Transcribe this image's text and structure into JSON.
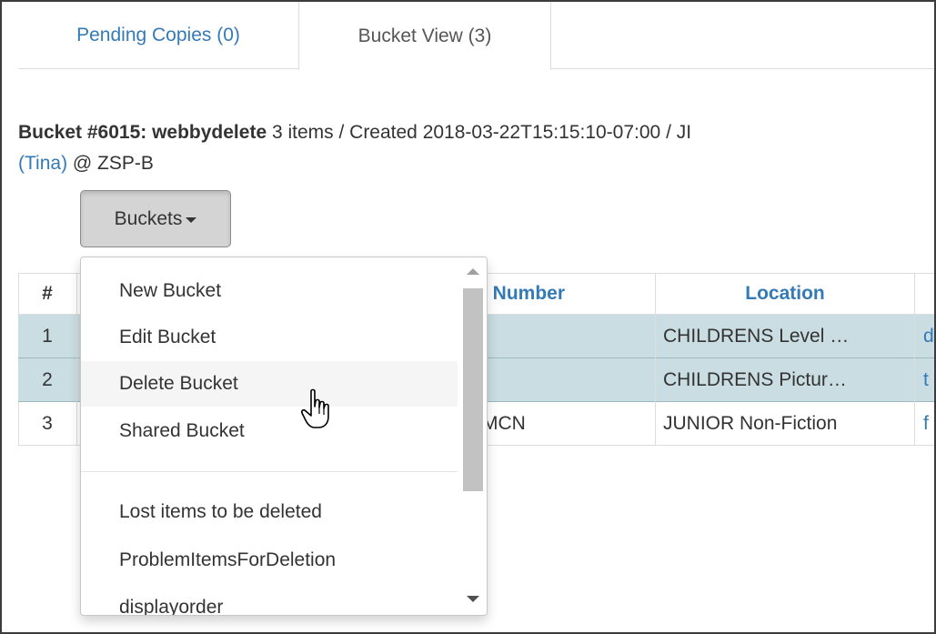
{
  "tabs": {
    "pending": "Pending Copies (0)",
    "bucket_view": "Bucket View (3)"
  },
  "bucket": {
    "title": "Bucket #6015: webbydelete",
    "meta": " 3 items / Created 2018-03-22T15:15:10-07:00 / JI",
    "user": "(Tina)",
    "location": " @ ZSP-B"
  },
  "buckets_button": {
    "label": "Buckets"
  },
  "table": {
    "headers": {
      "num": "#",
      "call_number": "l Number",
      "location": "Location"
    },
    "rows": [
      {
        "num": "1",
        "call": "",
        "location": "CHILDRENS Level …",
        "extra": "d",
        "selected": true
      },
      {
        "num": "2",
        "call": "",
        "location": "CHILDRENS Pictur…",
        "extra": "t",
        "selected": true
      },
      {
        "num": "3",
        "call": "MCN",
        "location": "JUNIOR Non-Fiction",
        "extra": "f",
        "selected": false
      }
    ]
  },
  "menu": {
    "items": [
      "New Bucket",
      "Edit Bucket",
      "Delete Bucket",
      "Shared Bucket"
    ],
    "saved_buckets": [
      "Lost items to be deleted",
      "ProblemItemsForDeletion",
      "displayorder"
    ],
    "hovered": "Delete Bucket"
  },
  "colors": {
    "link": "#337ab7",
    "selected_row": "#c9dde2",
    "button_bg": "#d4d4d4"
  }
}
